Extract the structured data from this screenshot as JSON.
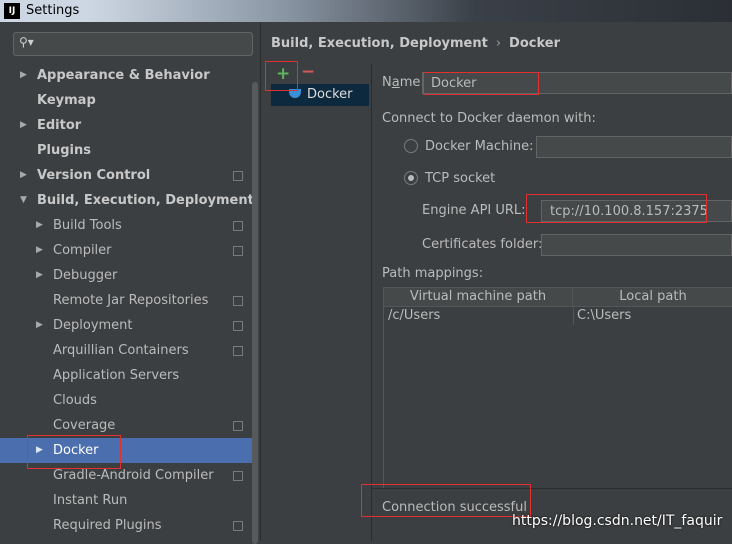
{
  "window": {
    "app_icon": "IJ",
    "title": "Settings"
  },
  "search": {
    "icon": "search-icon"
  },
  "sidebar": {
    "items": [
      {
        "label": "Appearance & Behavior"
      },
      {
        "label": "Keymap"
      },
      {
        "label": "Editor"
      },
      {
        "label": "Plugins"
      },
      {
        "label": "Version Control"
      },
      {
        "label": "Build, Execution, Deployment"
      },
      {
        "label": "Build Tools"
      },
      {
        "label": "Compiler"
      },
      {
        "label": "Debugger"
      },
      {
        "label": "Remote Jar Repositories"
      },
      {
        "label": "Deployment"
      },
      {
        "label": "Arquillian Containers"
      },
      {
        "label": "Application Servers"
      },
      {
        "label": "Clouds"
      },
      {
        "label": "Coverage"
      },
      {
        "label": "Docker"
      },
      {
        "label": "Gradle-Android Compiler"
      },
      {
        "label": "Instant Run"
      },
      {
        "label": "Required Plugins"
      }
    ]
  },
  "breadcrumb": {
    "parent": "Build, Execution, Deployment",
    "separator": "›",
    "current": "Docker"
  },
  "toolbar": {
    "add_label": "+",
    "remove_label": "−"
  },
  "docker_list": {
    "selected": "Docker"
  },
  "form": {
    "name_label_pre": "N",
    "name_label_mnemonic": "a",
    "name_label_post": "me:",
    "name_value": "Docker",
    "connect_label": "Connect to Docker daemon with:",
    "docker_machine_label": "Docker Machine:",
    "docker_machine_value": "",
    "tcp_socket_label": "TCP socket",
    "engine_api_label": "Engine API URL:",
    "engine_api_value": "tcp://10.100.8.157:2375",
    "certs_label": "Certificates folder:",
    "certs_value": "",
    "path_mappings_label": "Path mappings:"
  },
  "path_table": {
    "columns": [
      "Virtual machine path",
      "Local path"
    ],
    "rows": [
      [
        "/c/Users",
        "C:\\Users"
      ]
    ]
  },
  "status": {
    "text": "Connection successful"
  },
  "watermark": {
    "text": "https://blog.csdn.net/IT_faquir"
  },
  "colors": {
    "selection": "#4b6eaf",
    "annotation": "#e03030",
    "background": "#3c3f41"
  }
}
